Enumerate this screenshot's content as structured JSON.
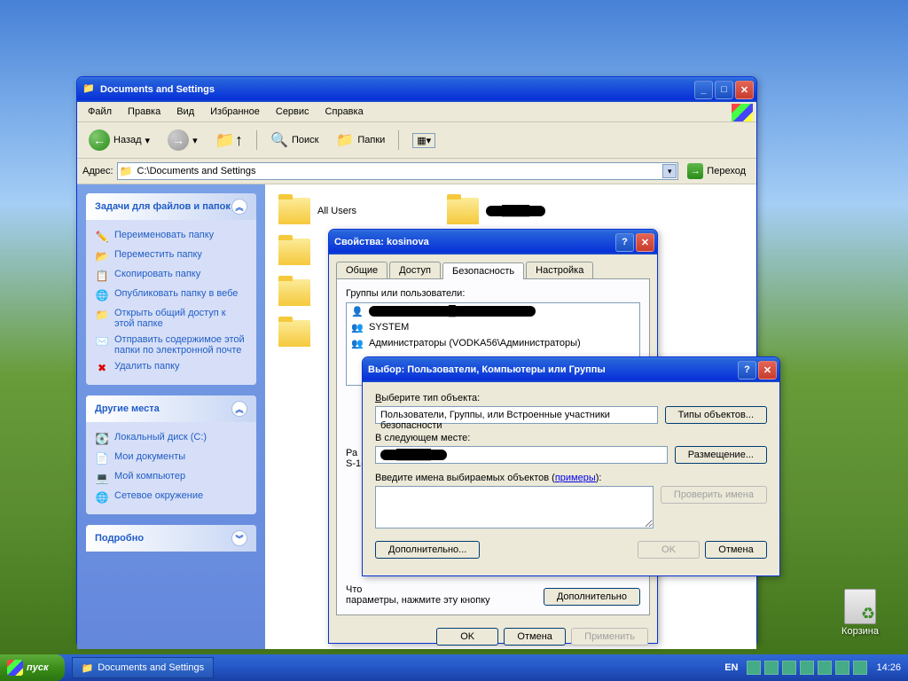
{
  "desktop": {
    "recycle_bin": "Корзина"
  },
  "taskbar": {
    "start": "пуск",
    "app": "Documents and Settings",
    "lang": "EN",
    "time": "14:26"
  },
  "explorer": {
    "title": "Documents and Settings",
    "menu": [
      "Файл",
      "Правка",
      "Вид",
      "Избранное",
      "Сервис",
      "Справка"
    ],
    "toolbar": {
      "back": "Назад",
      "search": "Поиск",
      "folders": "Папки"
    },
    "address_label": "Адрес:",
    "address_value": "C:\\Documents and Settings",
    "go": "Переход",
    "sidebar": {
      "panel1": {
        "title": "Задачи для файлов и папок",
        "items": [
          "Переименовать папку",
          "Переместить папку",
          "Скопировать папку",
          "Опубликовать папку в вебе",
          "Открыть общий доступ к этой папке",
          "Отправить содержимое этой папки по электронной почте",
          "Удалить папку"
        ]
      },
      "panel2": {
        "title": "Другие места",
        "items": [
          "Локальный диск (C:)",
          "Мои документы",
          "Мой компьютер",
          "Сетевое окружение"
        ]
      },
      "panel3": {
        "title": "Подробно"
      }
    },
    "folders": {
      "all_users": "All Users",
      "redacted": "████"
    }
  },
  "props": {
    "title": "Свойства: kosinova",
    "tabs": [
      "Общие",
      "Доступ",
      "Безопасность",
      "Настройка"
    ],
    "active_tab": 2,
    "groups_label": "Группы или пользователи:",
    "users": [
      {
        "name": "██████████████████████",
        "redacted": true
      },
      {
        "name": "SYSTEM"
      },
      {
        "name": "Администраторы (VODKA56\\Администраторы)"
      }
    ],
    "perm_prefix": "Ра",
    "sid_prefix": "S-1-",
    "note": "Что\nпараметры, нажмите эту кнопку",
    "additional": "Дополнительно",
    "ok": "OK",
    "cancel": "Отмена",
    "apply": "Применить"
  },
  "select": {
    "title": "Выбор: Пользователи, Компьютеры или Группы",
    "object_type_label": "Выберите тип объекта:",
    "object_type_value": "Пользователи, Группы, или Встроенные участники безопасности",
    "object_types_btn": "Типы объектов...",
    "location_label": "В следующем месте:",
    "location_value": "██████",
    "location_btn": "Размещение...",
    "names_label_1": "Введите имена выбираемых объектов (",
    "names_label_link": "примеры",
    "names_label_2": "):",
    "check_names": "Проверить имена",
    "advanced": "Дополнительно...",
    "ok": "OK",
    "cancel": "Отмена"
  }
}
